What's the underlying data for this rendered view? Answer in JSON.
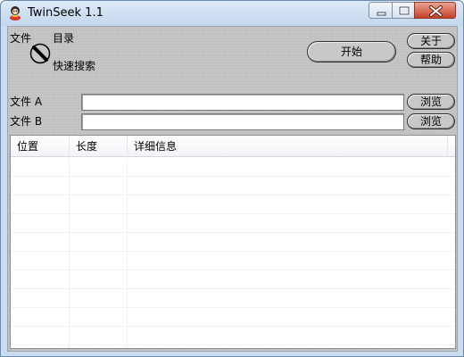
{
  "window": {
    "title": "TwinSeek 1.1"
  },
  "mode": {
    "file_label": "文件",
    "dir_label": "目录",
    "quick_search_label": "快速搜索"
  },
  "buttons": {
    "start": "开始",
    "about": "关于",
    "help": "帮助",
    "browse": "浏览"
  },
  "inputs": {
    "file_a_label": "文件 A",
    "file_a_value": "",
    "file_b_label": "文件 B",
    "file_b_value": ""
  },
  "results": {
    "columns": [
      "位置",
      "长度",
      "详细信息"
    ],
    "rows": []
  },
  "icons": {
    "app": "twinseek-app-icon",
    "knob": "mode-dial-icon"
  }
}
